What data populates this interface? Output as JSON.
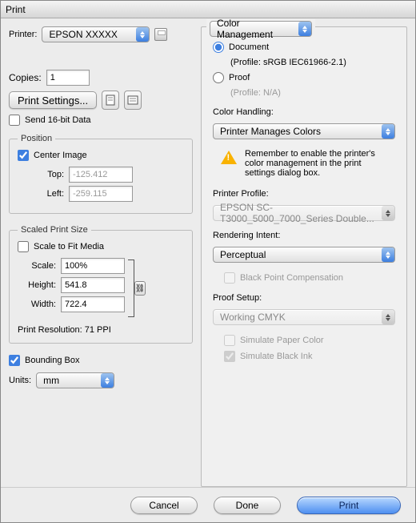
{
  "title": "Print",
  "left": {
    "printer_label": "Printer:",
    "printer_value": "EPSON XXXXX",
    "copies_label": "Copies:",
    "copies_value": "1",
    "print_settings_btn": "Print Settings...",
    "send16_label": "Send 16-bit Data",
    "position_legend": "Position",
    "center_image_label": "Center Image",
    "top_label": "Top:",
    "top_value": "-125.412",
    "left_label": "Left:",
    "left_value": "-259.115",
    "scaled_legend": "Scaled Print Size",
    "scale_to_fit_label": "Scale to Fit Media",
    "scale_label": "Scale:",
    "scale_value": "100%",
    "height_label": "Height:",
    "height_value": "541.8",
    "width_label": "Width:",
    "width_value": "722.4",
    "print_res": "Print Resolution: 71 PPI",
    "bounding_box_label": "Bounding Box",
    "units_label": "Units:",
    "units_value": "mm"
  },
  "right": {
    "section_select": "Color Management",
    "document_label": "Document",
    "document_profile": "(Profile: sRGB IEC61966-2.1)",
    "proof_label": "Proof",
    "proof_profile": "(Profile: N/A)",
    "color_handling_label": "Color Handling:",
    "color_handling_value": "Printer Manages Colors",
    "reminder": "Remember to enable the printer's color management in the print settings dialog box.",
    "printer_profile_label": "Printer Profile:",
    "printer_profile_value": "EPSON SC-T3000_5000_7000_Series Double...",
    "rendering_intent_label": "Rendering Intent:",
    "rendering_intent_value": "Perceptual",
    "black_point_label": "Black Point Compensation",
    "proof_setup_label": "Proof Setup:",
    "proof_setup_value": "Working CMYK",
    "simulate_paper_label": "Simulate Paper Color",
    "simulate_black_label": "Simulate Black Ink"
  },
  "footer": {
    "cancel": "Cancel",
    "done": "Done",
    "print": "Print"
  }
}
